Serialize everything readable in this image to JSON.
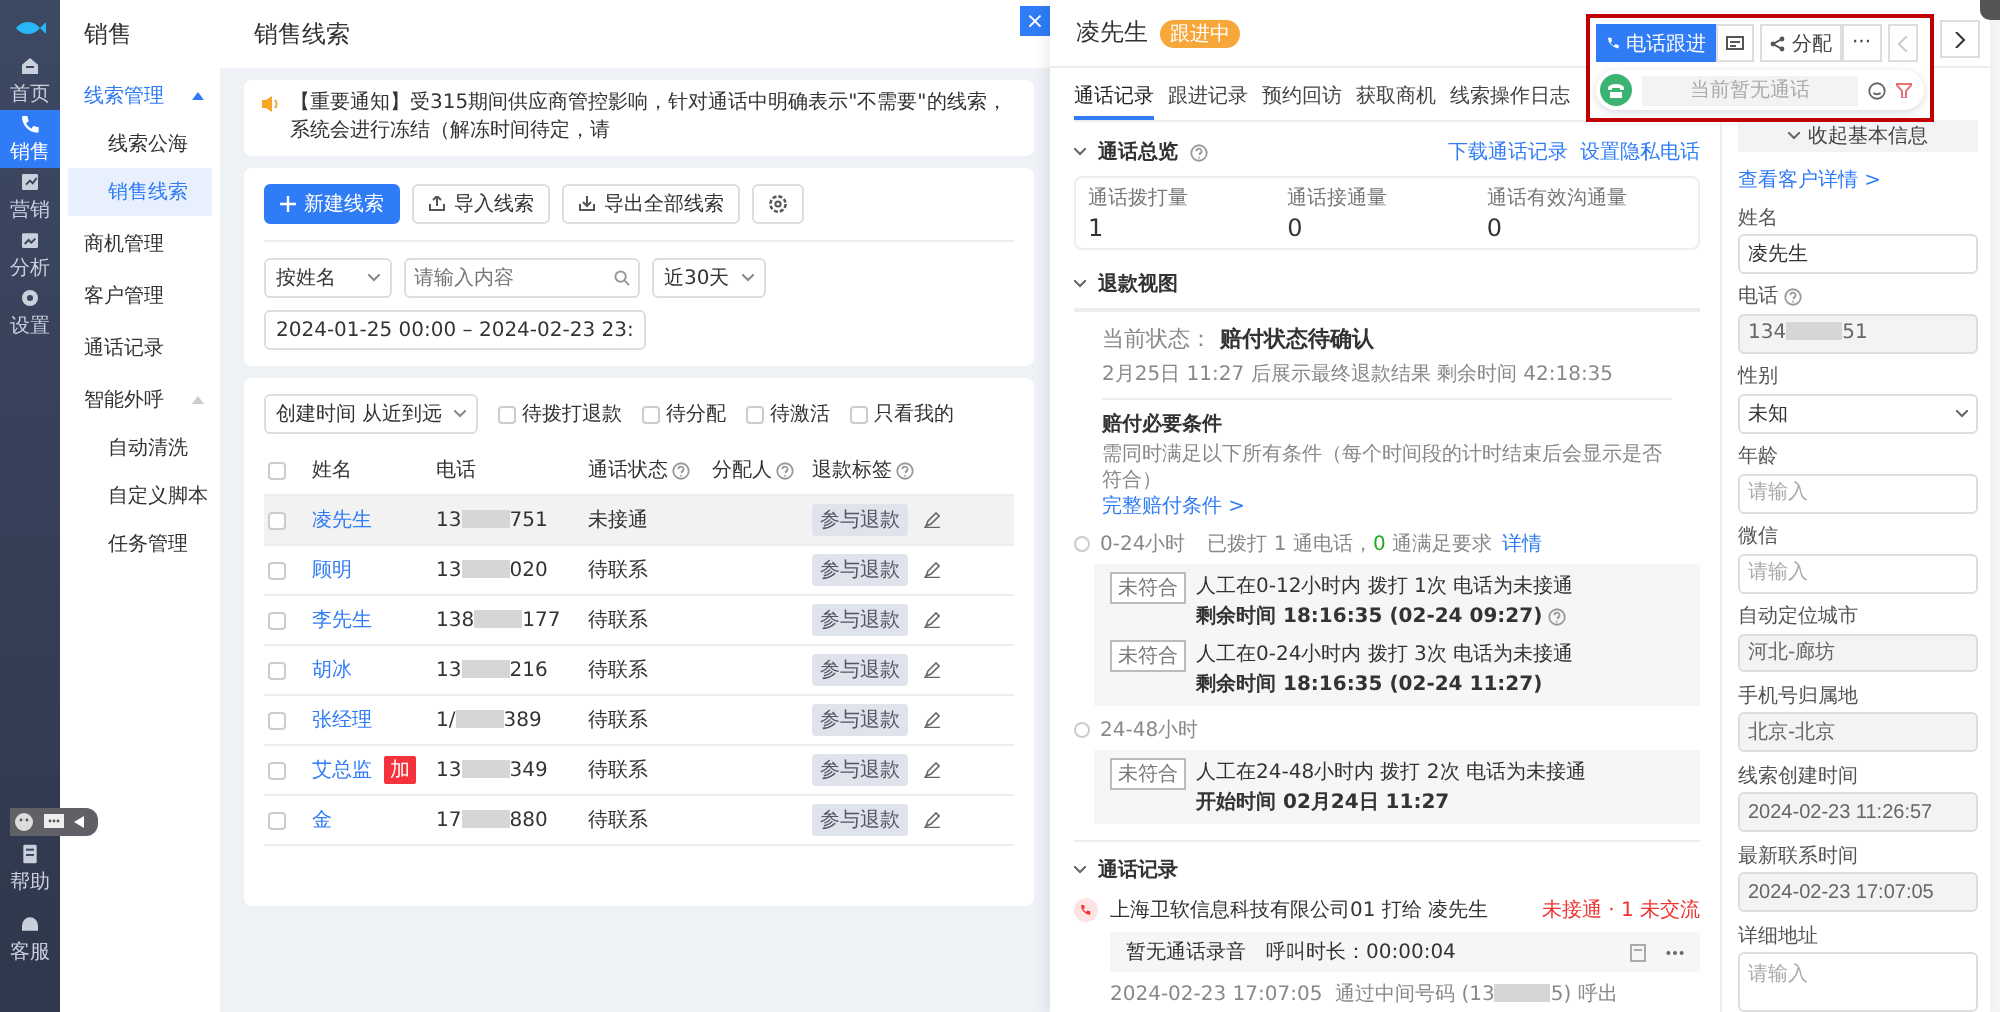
{
  "rail": {
    "items": [
      {
        "label": "首页",
        "selected": false
      },
      {
        "label": "销售",
        "selected": true
      },
      {
        "label": "营销",
        "selected": false
      },
      {
        "label": "分析",
        "selected": false
      },
      {
        "label": "设置",
        "selected": false
      }
    ],
    "bottom": [
      {
        "label": "帮助"
      },
      {
        "label": "客服"
      }
    ]
  },
  "submenu": {
    "title": "销售",
    "groups": [
      {
        "label": "线索管理",
        "active": true,
        "expanded": true,
        "children": [
          {
            "label": "线索公海",
            "selected": false
          },
          {
            "label": "销售线索",
            "selected": true
          }
        ]
      },
      {
        "label": "商机管理",
        "active": false
      },
      {
        "label": "客户管理",
        "active": false
      },
      {
        "label": "通话记录",
        "active": false
      },
      {
        "label": "智能外呼",
        "active": false,
        "expanded": true,
        "children": [
          {
            "label": "自动清洗",
            "selected": false
          },
          {
            "label": "自定义脚本",
            "selected": false
          },
          {
            "label": "任务管理",
            "selected": false
          }
        ]
      }
    ]
  },
  "main": {
    "title": "销售线索",
    "close": "×",
    "notice": "【重要通知】受315期间供应商管控影响，针对通话中明确表示\"不需要\"的线索，系统会进行冻结（解冻时间待定，请",
    "buttons": [
      {
        "kind": "primary",
        "label": "新建线索"
      },
      {
        "kind": "import",
        "label": "导入线索"
      },
      {
        "kind": "export",
        "label": "导出全部线索"
      }
    ],
    "filters": {
      "field": "按姓名",
      "search_placeholder": "请输入内容",
      "range": "近30天",
      "dates": "2024-01-25 00:00 – 2024-02-23 23:"
    },
    "sort": "创建时间 从近到远",
    "checks": [
      {
        "label": "待拨打退款",
        "checked": false
      },
      {
        "label": "待分配",
        "checked": false
      },
      {
        "label": "待激活",
        "checked": false
      },
      {
        "label": "只看我的",
        "checked": false
      }
    ],
    "table": {
      "select_all_checked": false,
      "columns": [
        {
          "label": "姓名",
          "help": false
        },
        {
          "label": "电话",
          "help": false
        },
        {
          "label": "通话状态",
          "help": true
        },
        {
          "label": "分配人",
          "help": true
        },
        {
          "label": "退款标签",
          "help": true
        }
      ],
      "rows": [
        {
          "name": "凌先生",
          "phone_prefix": "13",
          "phone_suffix": "751",
          "status": "未接通",
          "refund_tag": "参与退款",
          "highlighted": true,
          "checked": false
        },
        {
          "name": "顾明",
          "phone_prefix": "13",
          "phone_suffix": "020",
          "status": "待联系",
          "refund_tag": "参与退款",
          "highlighted": false,
          "checked": false
        },
        {
          "name": "李先生",
          "phone_prefix": "138",
          "phone_suffix": "177",
          "status": "待联系",
          "refund_tag": "参与退款",
          "highlighted": false,
          "checked": false
        },
        {
          "name": "胡冰",
          "phone_prefix": "13",
          "phone_suffix": "216",
          "status": "待联系",
          "refund_tag": "参与退款",
          "highlighted": false,
          "checked": false
        },
        {
          "name": "张经理",
          "phone_prefix": "1/",
          "phone_suffix": "389",
          "status": "待联系",
          "refund_tag": "参与退款",
          "highlighted": false,
          "checked": false
        },
        {
          "name": "艾总监",
          "tag": "加",
          "phone_prefix": "13",
          "phone_suffix": "349",
          "status": "待联系",
          "refund_tag": "参与退款",
          "highlighted": false,
          "checked": false
        },
        {
          "name": "金",
          "phone_prefix": "17",
          "phone_suffix": "880",
          "status": "待联系",
          "refund_tag": "参与退款",
          "highlighted": false,
          "checked": false
        }
      ]
    }
  },
  "drawer": {
    "name": "凌先生",
    "status_tag": "跟进中",
    "actions": {
      "call": "电话跟进",
      "assign": "分配",
      "more": "···",
      "call_status": "当前暂无通话"
    },
    "tabs": [
      {
        "label": "通话记录",
        "selected": true
      },
      {
        "label": "跟进记录",
        "selected": false
      },
      {
        "label": "预约回访",
        "selected": false
      },
      {
        "label": "获取商机",
        "selected": false
      },
      {
        "label": "线索操作日志",
        "selected": false
      }
    ],
    "overview": {
      "title": "通话总览",
      "links": [
        "下载通话记录",
        "设置隐私电话"
      ],
      "stats": [
        {
          "label": "通话拨打量",
          "value": "1"
        },
        {
          "label": "通话接通量",
          "value": "0"
        },
        {
          "label": "通话有效沟通量",
          "value": "0"
        }
      ]
    },
    "refund": {
      "title": "退款视图",
      "state_label": "当前状态：",
      "state": "赔付状态待确认",
      "note": "2月25日 11:27 后展示最终退款结果 剩余时间 42:18:35",
      "conditions_title": "赔付必要条件",
      "conditions_desc": "需同时满足以下所有条件（每个时间段的计时结束后会显示是否符合）",
      "conditions_link": "完整赔付条件 >",
      "periods": [
        {
          "label": "0-24小时",
          "summary": "已拨打 1 通电话，",
          "ok_count": "0",
          "ok_text": "通满足要求",
          "detail_link": "详情",
          "rules": [
            {
              "badge": "未符合",
              "text": "人工在0-12小时内 拨打 1次 电话为未接通",
              "time": "剩余时间 18:16:35 (02-24 09:27)",
              "help": true
            },
            {
              "badge": "未符合",
              "text": "人工在0-24小时内 拨打 3次 电话为未接通",
              "time": "剩余时间 18:16:35 (02-24 11:27)",
              "help": false
            }
          ]
        },
        {
          "label": "24-48小时",
          "rules": [
            {
              "badge": "未符合",
              "text": "人工在24-48小时内 拨打 2次 电话为未接通",
              "time": "开始时间 02月24日 11:27",
              "help": false
            }
          ]
        }
      ]
    },
    "calls": {
      "title": "通话记录",
      "items": [
        {
          "caller": "上海卫软信息科技有限公司01 打给 凌先生",
          "result": "未接通 · 1 未交流",
          "recording": "暂无通话录音",
          "duration": "呼叫时长：00:00:04",
          "time": "2024-02-23 17:07:05",
          "via_prefix": "通过中间号码 (13",
          "via_suffix": "5) 呼出"
        }
      ]
    },
    "collapse_button": "收起基本信息",
    "customer_link": "查看客户详情 >",
    "fields": [
      {
        "label": "姓名",
        "kind": "input",
        "value": "凌先生",
        "disabled": false
      },
      {
        "label": "电话",
        "kind": "masked",
        "help": true,
        "prefix": "134",
        "suffix": "51",
        "disabled": true
      },
      {
        "label": "性别",
        "kind": "select",
        "value": "未知",
        "disabled": false
      },
      {
        "label": "年龄",
        "kind": "input",
        "placeholder": "请输入",
        "disabled": false
      },
      {
        "label": "微信",
        "kind": "input",
        "placeholder": "请输入",
        "disabled": false
      },
      {
        "label": "自动定位城市",
        "kind": "input",
        "value": "河北-廊坊",
        "disabled": true
      },
      {
        "label": "手机号归属地",
        "kind": "input",
        "value": "北京-北京",
        "disabled": true
      },
      {
        "label": "线索创建时间",
        "kind": "input",
        "value": "2024-02-23 11:26:57",
        "disabled": true
      },
      {
        "label": "最新联系时间",
        "kind": "input",
        "value": "2024-02-23 17:07:05",
        "disabled": true
      },
      {
        "label": "详细地址",
        "kind": "textarea",
        "placeholder": "请输入",
        "disabled": false
      }
    ]
  }
}
